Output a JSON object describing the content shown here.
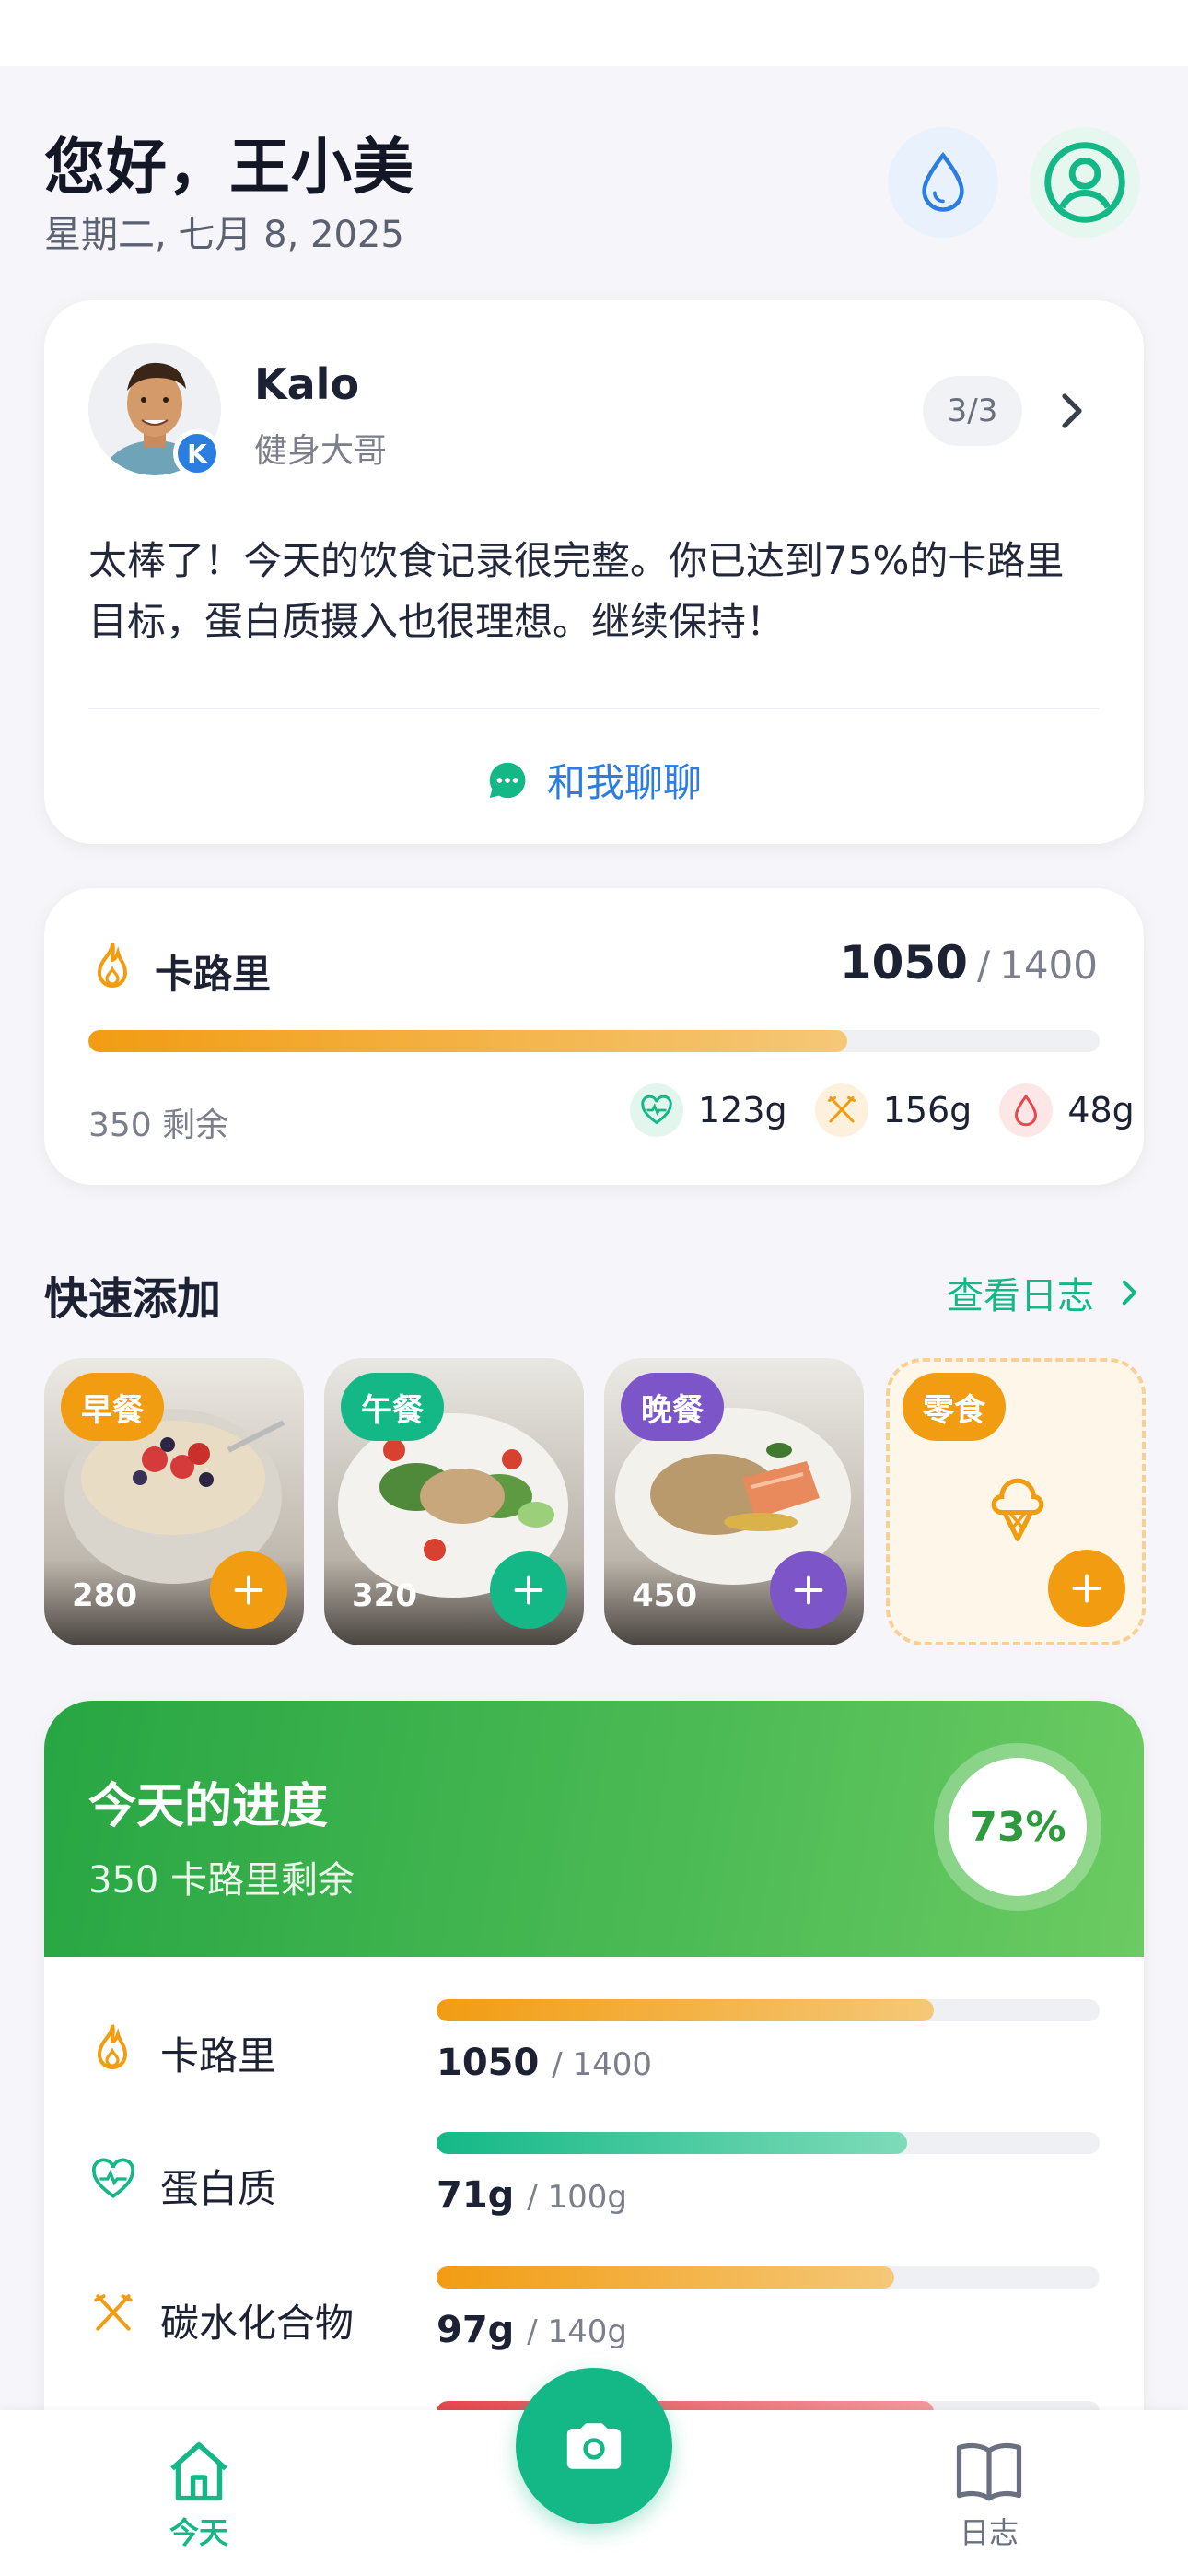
{
  "header": {
    "greeting": "您好，王小美",
    "date": "星期二, 七月 8, 2025",
    "water_icon": "water-drop-icon",
    "profile_icon": "user-circle-icon"
  },
  "coach": {
    "name": "Kalo",
    "subtitle": "健身大哥",
    "badge_letter": "K",
    "page_indicator": "3/3",
    "message": "太棒了！今天的饮食记录很完整。你已达到75%的卡路里目标，蛋白质摄入也很理想。继续保持！",
    "chat_label": "和我聊聊"
  },
  "calorie_card": {
    "label": "卡路里",
    "consumed": "1050",
    "separator": "/",
    "goal": "1400",
    "progress": 0.75,
    "remaining": "350 剩余",
    "macros": [
      {
        "icon": "heart-pulse-icon",
        "value": "123g"
      },
      {
        "icon": "fork-knife-icon",
        "value": "156g"
      },
      {
        "icon": "drop-icon",
        "value": "48g"
      }
    ]
  },
  "quick_add": {
    "title": "快速添加",
    "view_log": "查看日志",
    "meals": [
      {
        "tag": "早餐",
        "calories": "280",
        "color": "#f29c12"
      },
      {
        "tag": "午餐",
        "calories": "320",
        "color": "#14b886"
      },
      {
        "tag": "晚餐",
        "calories": "450",
        "color": "#7c55c8"
      },
      {
        "tag": "零食",
        "calories": "",
        "color": "#f29c12"
      }
    ]
  },
  "progress": {
    "title": "今天的进度",
    "subtitle": "350 卡路里剩余",
    "percent": "73%",
    "rows": [
      {
        "label": "卡路里",
        "value": "1050",
        "goal": "/ 1400",
        "progress": 0.75
      },
      {
        "label": "蛋白质",
        "value": "71g",
        "goal": "/ 100g",
        "progress": 0.71
      },
      {
        "label": "碳水化合物",
        "value": "97g",
        "goal": "/ 140g",
        "progress": 0.69
      }
    ]
  },
  "bottom_nav": {
    "today": "今天",
    "log": "日志"
  },
  "colors": {
    "accent_green": "#14b886",
    "orange": "#f29c12",
    "purple": "#7c55c8",
    "red": "#e5484d",
    "blue": "#2b7de0"
  }
}
